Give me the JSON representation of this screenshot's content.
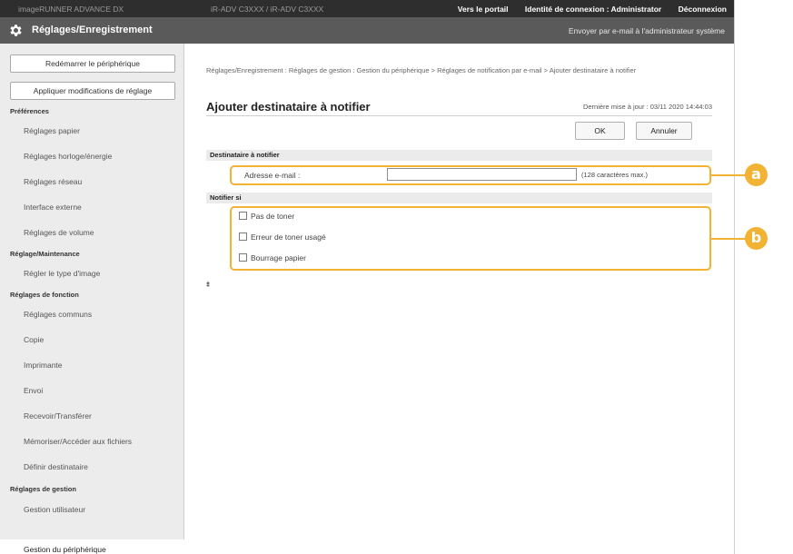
{
  "topbar": {
    "host": "imageRUNNER ADVANCE DX",
    "address": "iR-ADV C3XXX / iR-ADV C3XXX",
    "portal_link": "Vers le portail",
    "login_identity": "Identité de connexion : Administrator",
    "logout": "Déconnexion"
  },
  "titlebar": {
    "title": "Réglages/Enregistrement",
    "mail_admin": "Envoyer par e-mail à l'administrateur système"
  },
  "sidebar": {
    "restart_button": "Redémarrer le périphérique",
    "apply_button": "Appliquer modifications de réglage",
    "sections": [
      {
        "title": "Préférences",
        "items": [
          "Réglages papier",
          "Réglages horloge/énergie",
          "Réglages réseau",
          "Interface externe",
          "Réglages de volume"
        ]
      },
      {
        "title": "Réglage/Maintenance",
        "items": [
          "Régler le type d'image"
        ]
      },
      {
        "title": "Réglages de fonction",
        "items": [
          "Réglages communs",
          "Copie",
          "Imprimante",
          "Envoi",
          "Recevoir/Transférer",
          "Mémoriser/Accéder aux fichiers"
        ]
      },
      {
        "title": "",
        "items": [
          "Définir destinataire"
        ]
      },
      {
        "title": "Réglages de gestion",
        "items": [
          "Gestion utilisateur",
          "Gestion du périphérique"
        ]
      }
    ]
  },
  "main": {
    "breadcrumb": "Réglages/Enregistrement : Réglages de gestion : Gestion du périphérique > Réglages de notification par e-mail > Ajouter destinataire à notifier",
    "page_title": "Ajouter destinataire à notifier",
    "last_update": "Dernière mise à jour : 03/11 2020 14:44:03",
    "ok_button": "OK",
    "cancel_button": "Annuler",
    "dest_group": "Destinataire à notifier",
    "email_label": "Adresse e-mail :",
    "email_value": "",
    "email_hint": "(128 caractères max.)",
    "notify_group": "Notifier si",
    "options": [
      {
        "label": "Pas de toner",
        "checked": false
      },
      {
        "label": "Erreur de toner usagé",
        "checked": false
      },
      {
        "label": "Bourrage papier",
        "checked": false
      }
    ],
    "to_top": "⯒"
  },
  "callouts": {
    "a": "a",
    "b": "b"
  },
  "colors": {
    "accent": "#f2b233",
    "header": "#5a5a5a",
    "topbar": "#2e2e2e"
  }
}
